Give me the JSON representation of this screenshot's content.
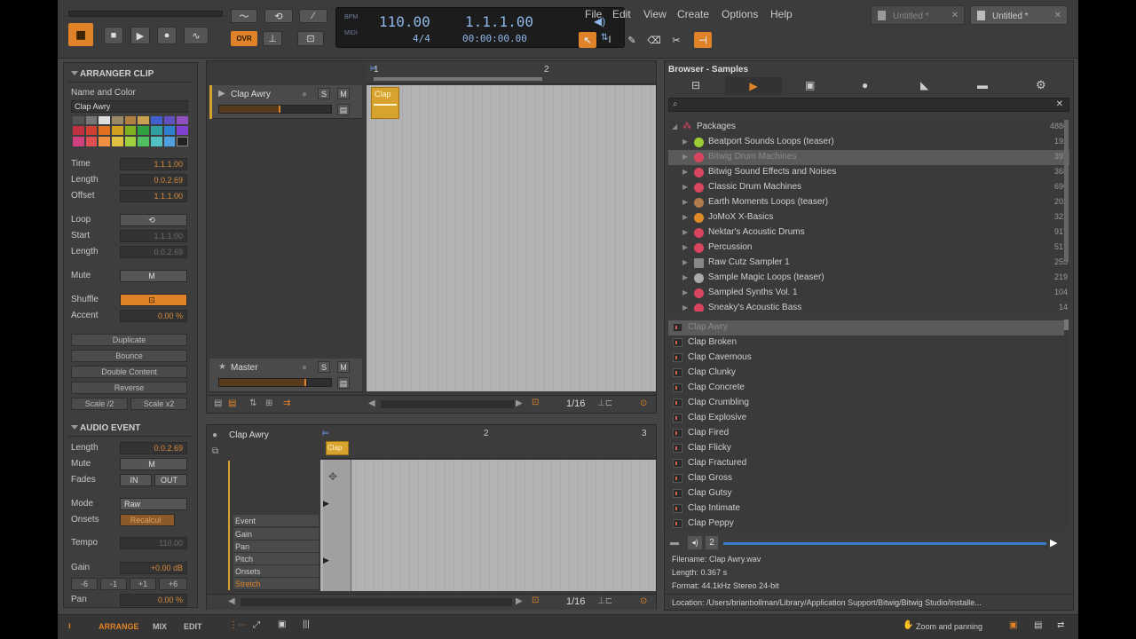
{
  "colors": {
    "accent": "#e08228",
    "clip": "#d7a22e",
    "lcd_text": "#8fb7e8"
  },
  "transport": {
    "tempo": "110.00",
    "signature": "4/4",
    "position": "1.1.1.00",
    "time": "00:00:00.00",
    "ovr_label": "OVR",
    "bpm_label": "BPM",
    "midi_label": "MIDI"
  },
  "menu": [
    "File",
    "Edit",
    "View",
    "Create",
    "Options",
    "Help"
  ],
  "doc_tabs": [
    {
      "label": "Untitled *"
    },
    {
      "label": "Untitled *"
    }
  ],
  "inspector": {
    "arranger_clip": {
      "title": "ARRANGER CLIP",
      "name_color_label": "Name and Color",
      "clip_name": "Clap Awry",
      "time_label": "Time",
      "time": "1.1.1.00",
      "length_label": "Length",
      "length": "0.0.2.69",
      "offset_label": "Offset",
      "offset": "1.1.1.00",
      "loop_label": "Loop",
      "start_label": "Start",
      "start": "1.1.1.00",
      "loop_length_label": "Length",
      "loop_length": "0.0.2.69",
      "mute_label": "Mute",
      "mute_value": "M",
      "shuffle_label": "Shuffle",
      "accent_label": "Accent",
      "accent": "0.00 %",
      "duplicate": "Duplicate",
      "bounce": "Bounce",
      "double_content": "Double Content",
      "reverse": "Reverse",
      "scale_half": "Scale /2",
      "scale_double": "Scale x2"
    },
    "audio_event": {
      "title": "AUDIO EVENT",
      "length_label": "Length",
      "length": "0.0.2.69",
      "mute_label": "Mute",
      "mute_value": "M",
      "fades_label": "Fades",
      "fade_in": "IN",
      "fade_out": "OUT",
      "mode_label": "Mode",
      "mode": "Raw",
      "onsets_label": "Onsets",
      "onsets": "Recalcul",
      "tempo_label": "Tempo",
      "tempo": "110.00",
      "gain_label": "Gain",
      "gain": "+0.00 dB",
      "gain_steps": [
        "-6",
        "-1",
        "+1",
        "+6"
      ],
      "pan_label": "Pan",
      "pan": "0.00 %"
    }
  },
  "arranger": {
    "ruler": [
      "1",
      "2"
    ],
    "tracks": [
      {
        "name": "Clap Awry"
      },
      {
        "name": "Master"
      }
    ],
    "clip_label": "Clap",
    "quantize": "1/16",
    "sm": [
      "S",
      "M"
    ]
  },
  "editor": {
    "title": "Clap Awry",
    "ruler": [
      "1",
      "2",
      "3"
    ],
    "clip_label": "Clap",
    "lanes": [
      "Event",
      "Gain",
      "Pan",
      "Pitch",
      "Onsets",
      "Stretch"
    ],
    "quantize": "1/16"
  },
  "browser": {
    "title": "Browser - Samples",
    "packages_label": "Packages",
    "packages_count": "4886",
    "packages": [
      {
        "name": "Beatport Sounds Loops (teaser)",
        "count": "192",
        "color": "#9acd32"
      },
      {
        "name": "Bitwig Drum Machines",
        "count": "397",
        "color": "#d9455f"
      },
      {
        "name": "Bitwig Sound Effects and Noises",
        "count": "368",
        "color": "#d9455f"
      },
      {
        "name": "Classic Drum Machines",
        "count": "696",
        "color": "#d9455f"
      },
      {
        "name": "Earth Moments Loops (teaser)",
        "count": "202",
        "color": "#b07a4a"
      },
      {
        "name": "JoMoX X-Basics",
        "count": "322",
        "color": "#e08a28"
      },
      {
        "name": "Nektar's Acoustic Drums",
        "count": "917",
        "color": "#d9455f"
      },
      {
        "name": "Percussion",
        "count": "517",
        "color": "#d9455f"
      },
      {
        "name": "Raw Cutz Sampler 1",
        "count": "255",
        "color": "#888888"
      },
      {
        "name": "Sample Magic Loops (teaser)",
        "count": "219",
        "color": "#aaaaaa"
      },
      {
        "name": "Sampled Synths Vol. 1",
        "count": "104",
        "color": "#d9455f"
      },
      {
        "name": "Sneaky's Acoustic Bass",
        "count": "14",
        "color": "#d9455f"
      }
    ],
    "files": [
      "Clap Awry",
      "Clap Broken",
      "Clap Cavernous",
      "Clap Clunky",
      "Clap Concrete",
      "Clap Crumbling",
      "Clap Explosive",
      "Clap Fired",
      "Clap Flicky",
      "Clap Fractured",
      "Clap Gross",
      "Clap Gutsy",
      "Clap Intimate",
      "Clap Peppy"
    ],
    "preview_num": "2",
    "filename_label": "Filename:",
    "filename": "Clap Awry.wav",
    "length_label": "Length:",
    "length": "0.367 s",
    "format_label": "Format:",
    "format": "44.1kHz Stereo 24-bit",
    "location_label": "Location:",
    "location": "/Users/brianbollman/Library/Application Support/Bitwig/Bitwig Studio/installe..."
  },
  "statusbar": {
    "views": [
      "ARRANGE",
      "MIX",
      "EDIT"
    ],
    "zoom": "Zoom and panning"
  }
}
